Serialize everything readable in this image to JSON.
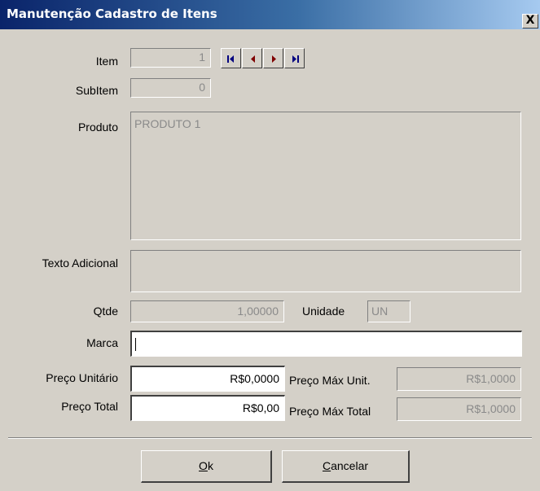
{
  "window": {
    "title": "Manutenção Cadastro de Itens",
    "close_glyph": "X"
  },
  "labels": {
    "item": "Item",
    "subitem": "SubItem",
    "produto": "Produto",
    "texto_adicional": "Texto Adicional",
    "qtde": "Qtde",
    "unidade": "Unidade",
    "marca": "Marca",
    "preco_unitario": "Preço Unitário",
    "preco_total": "Preço Total",
    "preco_max_unit": "Preço Máx Unit.",
    "preco_max_total": "Preço Máx Total"
  },
  "fields": {
    "item": "1",
    "subitem": "0",
    "produto": "PRODUTO 1",
    "texto_adicional": "",
    "qtde": "1,00000",
    "unidade": "UN",
    "marca": "",
    "preco_unitario": "R$0,0000",
    "preco_total": "R$0,00",
    "preco_max_unit": "R$1,0000",
    "preco_max_total": "R$1,0000"
  },
  "navigator": {
    "icons": [
      "first-record-icon",
      "prior-record-icon",
      "next-record-icon",
      "last-record-icon"
    ],
    "colors": {
      "bar": "#00007f",
      "arrow": "#7f0000"
    }
  },
  "buttons": {
    "ok": {
      "mnemonic": "O",
      "rest": "k"
    },
    "cancelar": {
      "mnemonic": "C",
      "rest": "ancelar"
    }
  }
}
